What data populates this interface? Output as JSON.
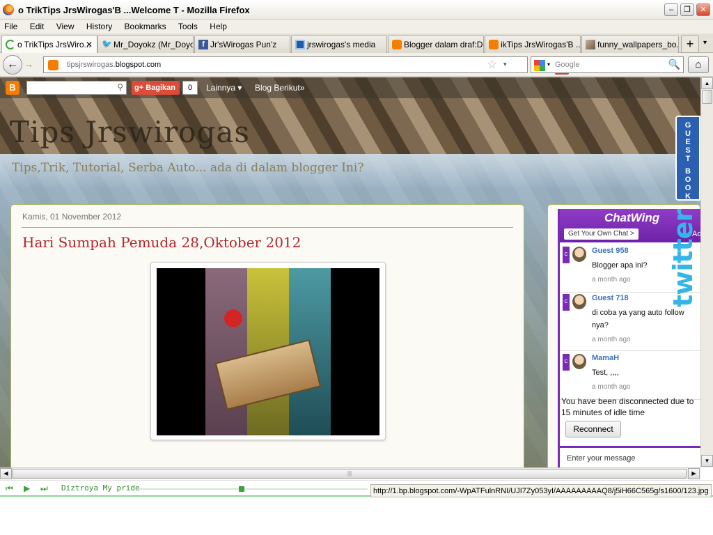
{
  "window": {
    "title": "o TrikTips JrsWirogas'B ...Welcome T - Mozilla Firefox",
    "min_glyph": "–",
    "max_glyph": "❐",
    "close_glyph": "✕"
  },
  "menu": [
    "File",
    "Edit",
    "View",
    "History",
    "Bookmarks",
    "Tools",
    "Help"
  ],
  "tabs": [
    {
      "label": "o TrikTips JrsWiro...",
      "active": true,
      "icon": "loading-icon"
    },
    {
      "label": "Mr_Doyokz (Mr_Doyo...",
      "active": false,
      "icon": "twitter-icon"
    },
    {
      "label": "Jr'sWirogas Pun'z",
      "active": false,
      "icon": "facebook-icon"
    },
    {
      "label": "jrswirogas's media",
      "active": false,
      "icon": "photobucket-icon"
    },
    {
      "label": "Blogger dalam draf:D...",
      "active": false,
      "icon": "blogger-icon"
    },
    {
      "label": "ikTips JrsWirogas'B ....",
      "active": false,
      "icon": "blogger-icon"
    },
    {
      "label": "funny_wallpapers_bo...",
      "active": false,
      "icon": "image-icon"
    }
  ],
  "tab_close_glyph": "✕",
  "new_tab_glyph": "+",
  "tab_list_glyph": "▾",
  "nav": {
    "url_prefix": "tipsjrswirogas.",
    "url_domain": "blogspot.com",
    "search_engine": "Google",
    "search_placeholder": "Google"
  },
  "blogger_bar": {
    "share_label": "Bagikan",
    "share_count": "0",
    "more_label": "Lainnya ▾",
    "next_blog_label": "Blog Berikut»"
  },
  "blog": {
    "title": "Tips Jrswirogas",
    "description": "Tips,Trik, Tutorial, Serba Auto... ada di dalam blogger Ini?"
  },
  "guestbook_letters": [
    "G",
    "U",
    "E",
    "S",
    "T",
    "",
    "B",
    "O",
    "O",
    "K"
  ],
  "post": {
    "date": "Kamis, 01 November 2012",
    "title": "Hari Sumpah Pemuda 28,Oktober 2012"
  },
  "chat": {
    "brand": "ChatWing",
    "own_chat_label": "Get Your Own Chat  >",
    "ad_label": "Ad",
    "messages": [
      {
        "user": "Guest 958",
        "text": "Blogger apa ini?",
        "time": "a month ago"
      },
      {
        "user": "Guest 718",
        "text": "di coba ya yang auto follow nya?",
        "time": "a month ago"
      },
      {
        "user": "MamaH",
        "text": "Test, ,,,,",
        "time": "a month ago"
      }
    ],
    "disconnected": "You have been disconnected due to 15 minutes of idle time",
    "reconnect_label": "Reconnect",
    "input_placeholder": "Enter your message"
  },
  "twitter_label": "twitter",
  "media": {
    "track": "Diztroya My pride",
    "progress": 0.45
  },
  "status_url": "http://1.bp.blogspot.com/-WpATFulnRNI/UJI7Zy053yI/AAAAAAAAAQ8/j5iH66C565g/s1600/123.jpg",
  "colors": {
    "blogger_orange": "#f57d00",
    "post_title": "#b1252a",
    "chatwing_purple": "#7a2bb5",
    "twitter_blue": "#36b6e8"
  }
}
